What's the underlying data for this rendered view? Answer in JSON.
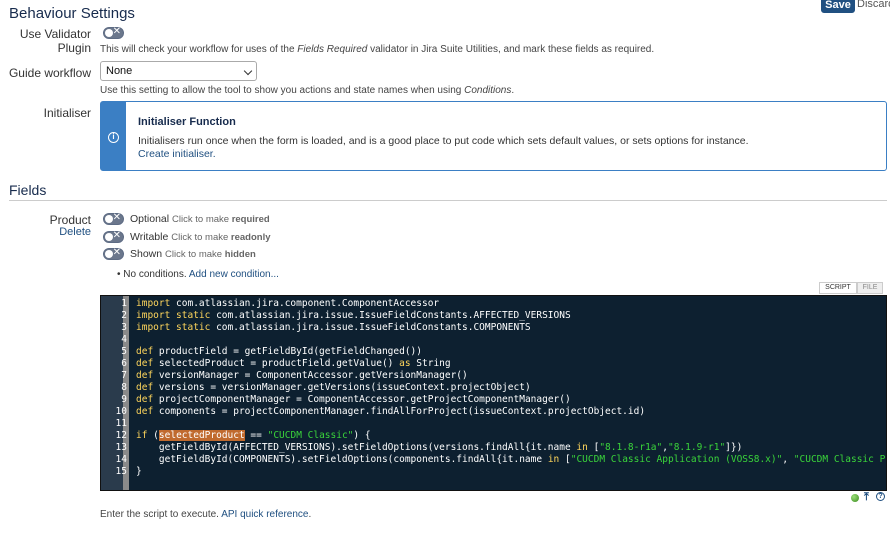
{
  "header": {
    "title": "Behaviour Settings",
    "save_label": "Save",
    "discard_label": "Discard"
  },
  "validator": {
    "label": "Use Validator Plugin",
    "help_prefix": "This will check your workflow for uses of the ",
    "help_em": "Fields Required",
    "help_suffix": " validator in Jira Suite Utilities, and mark these fields as required."
  },
  "guide": {
    "label": "Guide workflow",
    "selected": "None",
    "help_prefix": "Use this setting to allow the tool to show you actions and state names when using ",
    "help_em": "Conditions",
    "help_suffix": "."
  },
  "initialiser": {
    "label": "Initialiser",
    "panel_title": "Initialiser Function",
    "panel_text": "Initialisers run once when the form is loaded, and is a good place to put code which sets default values, or sets options for instance.",
    "create_link": "Create initialiser."
  },
  "fields": {
    "title": "Fields",
    "field_name": "Product",
    "delete_label": "Delete",
    "toggles": [
      {
        "state": "Optional",
        "hint_prefix": "Click to make ",
        "hint_bold": "required"
      },
      {
        "state": "Writable",
        "hint_prefix": "Click to make ",
        "hint_bold": "readonly"
      },
      {
        "state": "Shown",
        "hint_prefix": "Click to make ",
        "hint_bold": "hidden"
      }
    ],
    "conditions_text": "No conditions.",
    "add_condition": "Add new condition..."
  },
  "editor": {
    "tab_script": "SCRIPT",
    "tab_file": "FILE",
    "line_numbers": [
      "1",
      "2",
      "3",
      "4",
      "5",
      "6",
      "7",
      "8",
      "9",
      "10",
      "11",
      "12",
      "13",
      "14",
      "15"
    ],
    "lines": {
      "l1_kw": "import",
      "l1_rest": " com.atlassian.jira.component.ComponentAccessor",
      "l2_kw": "import static",
      "l2_rest": " com.atlassian.jira.issue.IssueFieldConstants.AFFECTED_VERSIONS",
      "l3_kw": "import static",
      "l3_rest": " com.atlassian.jira.issue.IssueFieldConstants.COMPONENTS",
      "l5_kw": "def",
      "l5_rest": " productField = getFieldById(getFieldChanged())",
      "l6_kw": "def",
      "l6_mid": " selectedProduct = productField.getValue() ",
      "l6_kw2": "as",
      "l6_rest": " String",
      "l7_kw": "def",
      "l7_rest": " versionManager = ComponentAccessor.getVersionManager()",
      "l8_kw": "def",
      "l8_rest": " versions = versionManager.getVersions(issueContext.projectObject)",
      "l9_kw": "def",
      "l9_rest": " projectComponentManager = ComponentAccessor.getProjectComponentManager()",
      "l10_kw": "def",
      "l10_rest": " components = projectComponentManager.findAllForProject(issueContext.projectObject.id)",
      "l12_kw": "if",
      "l12_a": " (",
      "l12_hl": "selectedProduct",
      "l12_b": " == ",
      "l12_str": "\"CUCDM Classic\"",
      "l12_c": ") {",
      "l13_a": "    getFieldById(AFFECTED_VERSIONS).setFieldOptions(versions.findAll{it.name ",
      "l13_kw": "in",
      "l13_b": " [",
      "l13_s1": "\"8.1.8-r1a\"",
      "l13_c": ",",
      "l13_s2": "\"8.1.9-r1\"",
      "l13_d": "]})",
      "l14_a": "    getFieldById(COMPONENTS).setFieldOptions(components.findAll{it.name ",
      "l14_kw": "in",
      "l14_b": " [",
      "l14_s1": "\"CUCDM Classic Application (VOSS8.x)\"",
      "l14_c": ", ",
      "l14_s2": "\"CUCDM Classic Platform (VOS",
      "l15": "}"
    },
    "footer_prefix": "Enter the script to execute. ",
    "footer_link": "API quick reference",
    "footer_suffix": "."
  },
  "colors": {
    "accent": "#205081",
    "info": "#3b7fc4",
    "editor_bg": "#0d2030"
  }
}
